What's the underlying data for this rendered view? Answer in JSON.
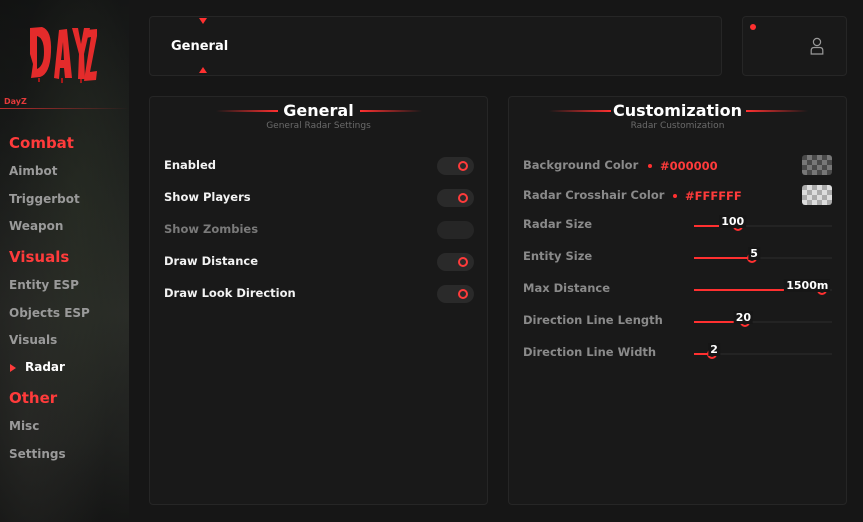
{
  "sidebar": {
    "brand": "DayZ",
    "sections": [
      {
        "title": "Combat",
        "items": [
          "Aimbot",
          "Triggerbot",
          "Weapon"
        ]
      },
      {
        "title": "Visuals",
        "items": [
          "Entity ESP",
          "Objects ESP",
          "Visuals",
          "Radar"
        ]
      },
      {
        "title": "Other",
        "items": [
          "Misc",
          "Settings"
        ]
      }
    ],
    "active_item": "Radar"
  },
  "tabbar": {
    "current_tab": "General"
  },
  "general_panel": {
    "title": "General",
    "subtitle": "General Radar Settings",
    "toggles": [
      {
        "label": "Enabled",
        "on": true,
        "enabled": true
      },
      {
        "label": "Show Players",
        "on": true,
        "enabled": true
      },
      {
        "label": "Show Zombies",
        "on": false,
        "enabled": false
      },
      {
        "label": "Draw Distance",
        "on": true,
        "enabled": true
      },
      {
        "label": "Draw Look Direction",
        "on": true,
        "enabled": true
      }
    ]
  },
  "custom_panel": {
    "title": "Customization",
    "subtitle": "Radar Customization",
    "colors": [
      {
        "label": "Background Color",
        "hex": "#000000"
      },
      {
        "label": "Radar Crosshair Color",
        "hex": "#FFFFFF"
      }
    ],
    "sliders": [
      {
        "label": "Radar Size",
        "value": "100",
        "fraction": 0.32
      },
      {
        "label": "Entity Size",
        "value": "5",
        "fraction": 0.42
      },
      {
        "label": "Max Distance",
        "value": "1500m",
        "fraction": 0.93
      },
      {
        "label": "Direction Line Length",
        "value": "20",
        "fraction": 0.37
      },
      {
        "label": "Direction Line Width",
        "value": "2",
        "fraction": 0.13
      }
    ]
  },
  "colors": {
    "accent": "#ff3030",
    "panel": "#191919",
    "bg": "#161616"
  },
  "icons": {
    "user": "user-icon",
    "active_marker": "arrow-right-icon"
  }
}
